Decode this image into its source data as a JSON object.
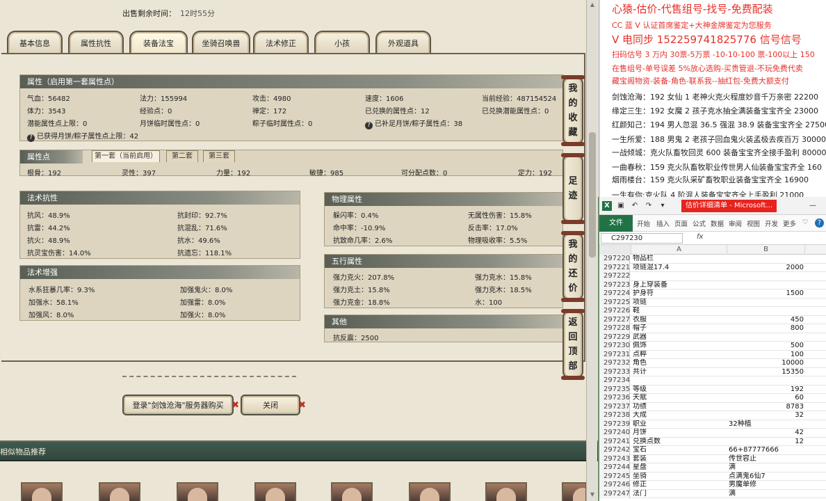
{
  "sale_time": {
    "label": "出售剩余时间：",
    "value": "12时55分"
  },
  "tabs": [
    "基本信息",
    "属性抗性",
    "装备法宝",
    "坐骑召唤兽",
    "法术修正",
    "小孩",
    "外观道具"
  ],
  "attr": {
    "header": "属性（启用第一套属性点）",
    "rows": [
      [
        "气血：56482",
        "法力：155994",
        "攻击：4980",
        "速度：1606",
        "当前经验：487154524"
      ],
      [
        "体力：3543",
        "经验点：0",
        "禅定：172",
        "已兑换的属性点：12",
        "已兑换潜能属性点：0"
      ],
      [
        "潜能属性点上限：0",
        "月饼临时属性点：0",
        "粽子临时属性点：0",
        "已补足月饼/粽子属性点：38"
      ]
    ],
    "note": "已获得月饼/粽子属性点上限：42"
  },
  "points": {
    "header": "属性点",
    "subtabs": [
      "第一套（当前启用）",
      "第二套",
      "第三套"
    ],
    "row": [
      "根骨：192",
      "灵性：397",
      "力量：192",
      "敏捷：985",
      "可分配点数：0",
      "定力：192"
    ]
  },
  "resist": {
    "header": "法术抗性",
    "items": [
      "抗风：48.9%",
      "抗封印：92.7%",
      "抗雷：44.2%",
      "抗混乱：71.6%",
      "抗火：48.9%",
      "抗水：49.6%",
      "抗灵宝伤害：14.0%",
      "抗遗忘：118.1%"
    ]
  },
  "enhance": {
    "header": "法术增强",
    "items": [
      "水系狂暴几率：9.3%",
      "加强鬼火：8.0%",
      "加强水：58.1%",
      "加强雷：8.0%",
      "加强风：8.0%",
      "加强火：8.0%"
    ]
  },
  "phys": {
    "header": "物理属性",
    "items": [
      "躲闪率：0.4%",
      "无属性伤害：15.8%",
      "命中率：-10.9%",
      "反击率：17.0%",
      "抗致命几率：2.6%",
      "物理吸收率：5.5%"
    ]
  },
  "five": {
    "header": "五行属性",
    "items": [
      "强力克火：207.8%",
      "强力克水：15.8%",
      "强力克土：15.8%",
      "强力克木：18.5%",
      "强力克金：18.8%",
      "水：100"
    ]
  },
  "other": {
    "header": "其他",
    "items": [
      "抗反震：2500"
    ]
  },
  "side_buttons": [
    [
      "我",
      "的",
      "收",
      "藏"
    ],
    [
      "足",
      "迹"
    ],
    [
      "我",
      "的",
      "还",
      "价"
    ],
    [
      "返",
      "回",
      "顶",
      "部"
    ]
  ],
  "buttons": {
    "login": "登录\"剑蚀沧海\"服务器购买",
    "close": "关闭"
  },
  "similar_title": "相似物品推荐",
  "doc_lines": [
    {
      "text": "心猿-估价-代售组号-找号-免费配装",
      "red": true,
      "big": true
    },
    {
      "text": "CC 蓝 V 认证首席鉴定+大神金牌鉴定为您服务",
      "red": true
    },
    {
      "text": "V 电同步 152259741825776 信号信号",
      "red": true,
      "big": true
    },
    {
      "text": "扫码估号 3 万内 30票-5万票 -10-10-100 票-100以上 150",
      "red": true
    },
    {
      "text": "在售组号-单号误差 5%放心选购-买贵管退-不玩免费代卖",
      "red": true
    },
    {
      "text": "藏宝阁物资-装备-角色-联系我--抽红包-免费大额支付",
      "red": true
    },
    {
      "text": "剑蚀沧海：192 女仙 1 老神火克火程度妙音千万亲密 22200",
      "red": false
    },
    {
      "text": "缘定三生：192 女魔 2 孩子克水抽全满装备宝宝齐全 23000",
      "red": false
    },
    {
      "text": "红颜知己：194 男人忽混 36.5 强混 38.9 装备宝宝齐全 27500",
      "red": false
    },
    {
      "text": "一生所爱：188 男鬼 2 老孩子回血鬼火装孟极去疾百万 30000",
      "red": false
    },
    {
      "text": "一战倾城：克火队畜牧回灵 600 装备宝宝齐全接手盈利 80000",
      "red": false
    },
    {
      "text": "一曲春秋：159 克火队畜牧职业传世男人仙装备宝宝齐全 160",
      "red": false
    },
    {
      "text": "烟雨楼台：159 克火队采矿畜牧职业装备宝宝齐全 16900",
      "red": false
    },
    {
      "text": "一生有你:克火队 4 阶混人装备宝宝齐全上手盈利 21000",
      "red": false
    }
  ],
  "excel": {
    "title": "估价详细清单 - Microsoft...",
    "ribbon_file": "文件",
    "ribbon_tabs": [
      "开始",
      "插入",
      "页面",
      "公式",
      "数据",
      "审阅",
      "视图",
      "开发",
      "更多"
    ],
    "namebox": "C297230",
    "fx": "fx",
    "col_headers": [
      "A",
      "B"
    ],
    "rows": [
      [
        "297220",
        "物品栏",
        ""
      ],
      [
        "297221",
        "项链混17.4",
        "2000"
      ],
      [
        "297222",
        "",
        ""
      ],
      [
        "297223",
        "身上穿装备",
        ""
      ],
      [
        "297224",
        "护身符",
        "1500"
      ],
      [
        "297225",
        "项链",
        ""
      ],
      [
        "297226",
        "鞋",
        ""
      ],
      [
        "297227",
        "衣服",
        "450"
      ],
      [
        "297228",
        "帽子",
        "800"
      ],
      [
        "297229",
        "武器",
        ""
      ],
      [
        "297230",
        "佩饰",
        "500"
      ],
      [
        "297231",
        "点粹",
        "100"
      ],
      [
        "297232",
        "角色",
        "10000"
      ],
      [
        "297233",
        "共计",
        "15350"
      ],
      [
        "297234",
        "",
        ""
      ],
      [
        "297235",
        "等级",
        "192"
      ],
      [
        "297236",
        "天赋",
        "60"
      ],
      [
        "297237",
        "功绩",
        "8783"
      ],
      [
        "297238",
        "大成",
        "32"
      ],
      [
        "297239",
        "职业",
        "32种植"
      ],
      [
        "297240",
        "月饼",
        "42"
      ],
      [
        "297241",
        "兑换点数",
        "12"
      ],
      [
        "297242",
        "宝石",
        "66+87777666"
      ],
      [
        "297243",
        "套装",
        "传世容止"
      ],
      [
        "297244",
        "星盘",
        "满"
      ],
      [
        "297245",
        "坐骑",
        "点满鬼6仙7"
      ],
      [
        "297246",
        "修正",
        "男魔单修"
      ],
      [
        "297247",
        "法门",
        "满"
      ]
    ]
  }
}
